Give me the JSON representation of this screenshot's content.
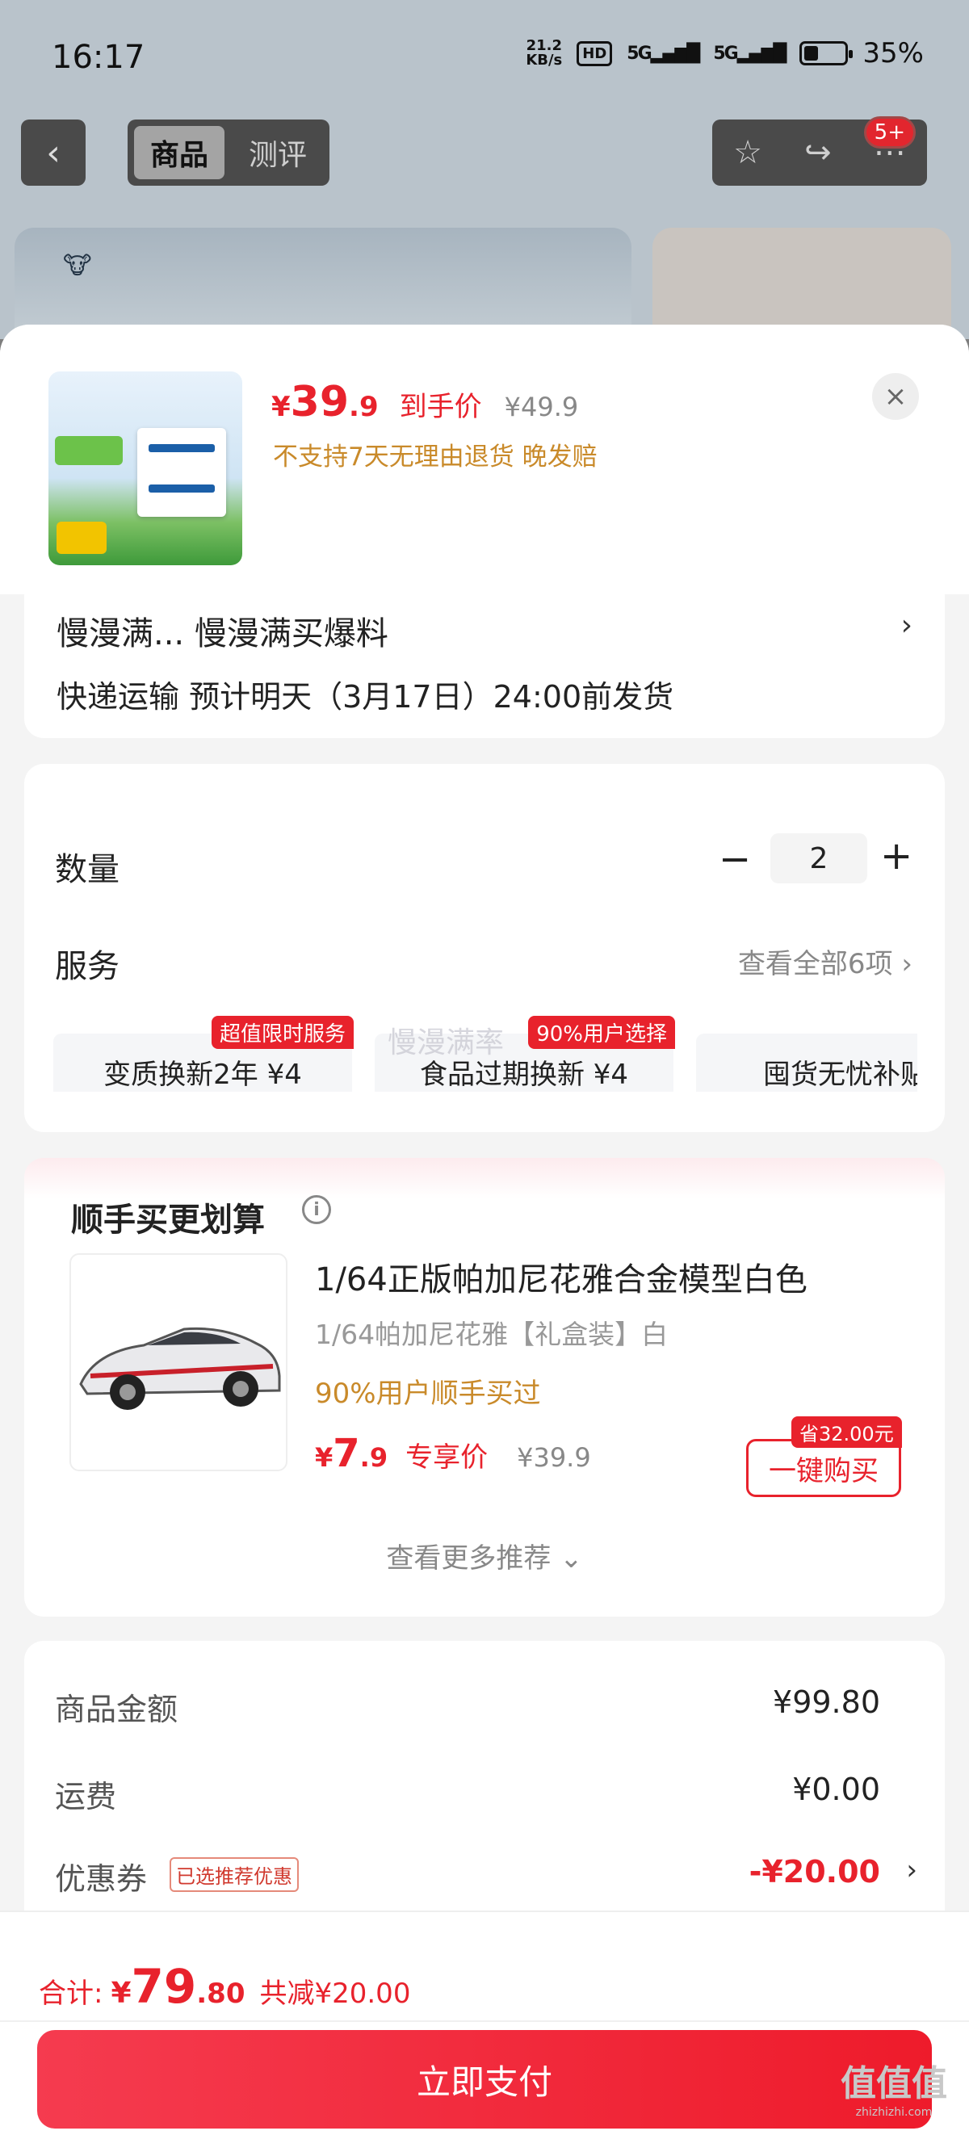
{
  "status_bar": {
    "time": "16:17",
    "net_speed_value": "21.2",
    "net_speed_unit": "KB/s",
    "hd": "HD",
    "signal1": "5G",
    "signal2": "5G",
    "battery": "35%",
    "battery_level": 0.35
  },
  "nav": {
    "tabs": [
      {
        "label": "商品",
        "active": true
      },
      {
        "label": "测评",
        "active": false
      }
    ],
    "badge": "5+"
  },
  "sheet": {
    "price_currency": "¥",
    "price_int": "39",
    "price_dec": ".9",
    "price_tag": "到手价",
    "price_original": "¥49.9",
    "return_policy": "不支持7天无理由退货  晚发赔",
    "close_icon": "×"
  },
  "description": {
    "text": "慢漫满...  慢漫满买爆料",
    "shipping": "快递运输  预计明天（3月17日）24:00前发货"
  },
  "quantity": {
    "label": "数量",
    "value": "2"
  },
  "services": {
    "label": "服务",
    "view_all": "查看全部6项",
    "items": [
      {
        "text": "变质换新2年  ¥4",
        "badge": "超值限时服务"
      },
      {
        "text": "食品过期换新  ¥4",
        "badge": "90%用户选择"
      },
      {
        "text": "囤货无忧补贴",
        "badge": ""
      }
    ],
    "watermark": "慢漫满率"
  },
  "bundle": {
    "title": "顺手买更划算",
    "product_name": "1/64正版帕加尼花雅合金模型白色",
    "spec": "1/64帕加尼花雅【礼盒装】白",
    "hint": "90%用户顺手买过",
    "price_currency": "¥",
    "price_int": "7",
    "price_dec": ".9",
    "price_tag": "专享价",
    "price_original": "¥39.9",
    "save_badge": "省32.00元",
    "buy_label": "一键购买",
    "more": "查看更多推荐 ⌄"
  },
  "fees": {
    "goods_label": "商品金额",
    "goods_value": "¥99.80",
    "shipping_label": "运费",
    "shipping_value": "¥0.00",
    "coupon_label": "优惠券",
    "coupon_chip": "已选推荐优惠",
    "coupon_value": "-¥20.00"
  },
  "footer": {
    "total_label": "合计:",
    "total_currency": "¥",
    "total_int": "79",
    "total_dec": ".80",
    "total_save": "共减¥20.00",
    "pay_label": "立即支付",
    "site_mark": "值值值",
    "site_url": "zhizhizhi.com"
  },
  "colors": {
    "accent": "#e8222c",
    "warning": "#c98a2a"
  }
}
